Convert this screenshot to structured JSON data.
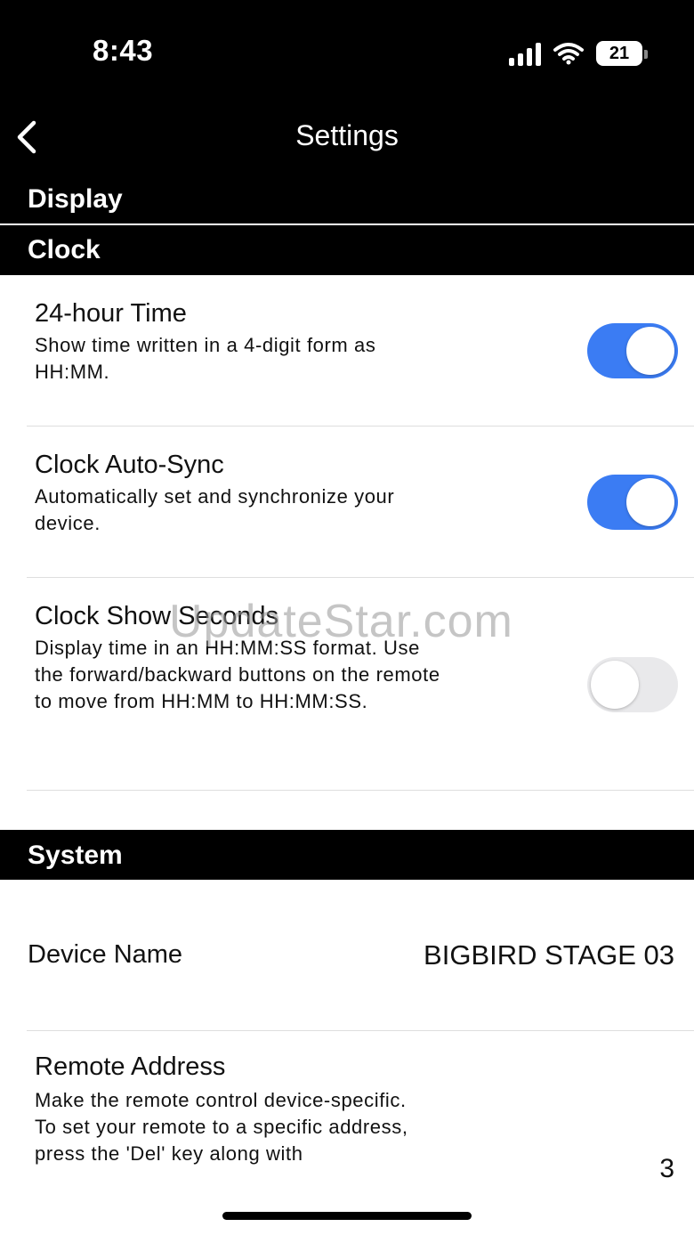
{
  "status_bar": {
    "time": "8:43",
    "battery": "21"
  },
  "nav": {
    "title": "Settings"
  },
  "sections": {
    "display": "Display",
    "clock": "Clock",
    "system": "System"
  },
  "clock_settings": [
    {
      "title": "24-hour Time",
      "desc": "Show time written in a 4-digit form as HH:MM.",
      "enabled": true
    },
    {
      "title": "Clock Auto-Sync",
      "desc": "Automatically set and synchronize your device.",
      "enabled": true
    },
    {
      "title": "Clock Show Seconds",
      "desc": "Display time in an HH:MM:SS format. Use the forward/backward buttons on the remote to move from HH:MM to HH:MM:SS.",
      "enabled": false
    }
  ],
  "system": {
    "device_name_label": "Device Name",
    "device_name_value": "BIGBIRD STAGE 03",
    "remote_address_label": "Remote Address",
    "remote_address_desc": "Make the remote control device-specific.\nTo set your remote to a specific address, press the 'Del' key along with",
    "remote_address_value": "3"
  },
  "watermark": "UpdateStar.com",
  "colors": {
    "toggle_on": "#3b7cf3",
    "toggle_off": "#e9e9eb",
    "header_bg": "#000000"
  }
}
